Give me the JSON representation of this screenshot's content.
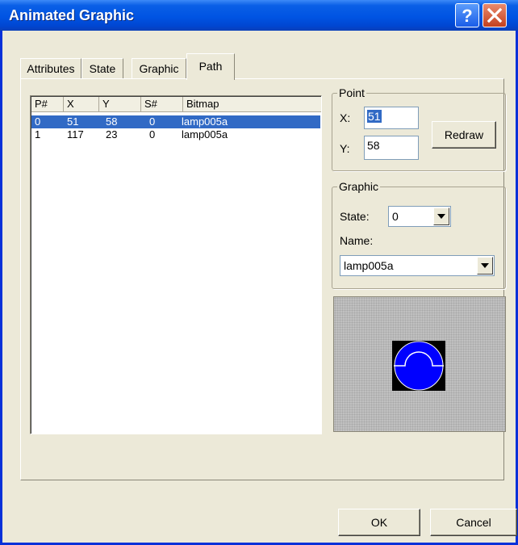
{
  "window": {
    "title": "Animated Graphic",
    "help_label": "?",
    "close_label": "X"
  },
  "tabs": [
    {
      "label": "Attributes",
      "active": false
    },
    {
      "label": "State",
      "active": false
    },
    {
      "label": "Graphic",
      "active": false
    },
    {
      "label": "Path",
      "active": true
    }
  ],
  "path_list": {
    "columns": [
      "P#",
      "X",
      "Y",
      "S#",
      "Bitmap"
    ],
    "rows": [
      {
        "p": "0",
        "x": "51",
        "y": "58",
        "s": "0",
        "bitmap": "lamp005a",
        "selected": true
      },
      {
        "p": "1",
        "x": "117",
        "y": "23",
        "s": "0",
        "bitmap": "lamp005a",
        "selected": false
      }
    ]
  },
  "point_group": {
    "legend": "Point",
    "x_label": "X:",
    "x_value": "51",
    "y_label": "Y:",
    "y_value": "58",
    "redraw_label": "Redraw"
  },
  "graphic_group": {
    "legend": "Graphic",
    "state_label": "State:",
    "state_value": "0",
    "name_label": "Name:",
    "name_value": "lamp005a"
  },
  "preview": {
    "icon": "lamp-icon",
    "colors": {
      "background": "#000000",
      "lamp": "#0000ff",
      "outline": "#ffffff",
      "pattern": "#c0c0c0"
    }
  },
  "buttons": {
    "ok_label": "OK",
    "cancel_label": "Cancel"
  },
  "colors": {
    "title_bar": "#0054e3",
    "dialog_bg": "#ece9d8",
    "selection": "#316ac5"
  }
}
